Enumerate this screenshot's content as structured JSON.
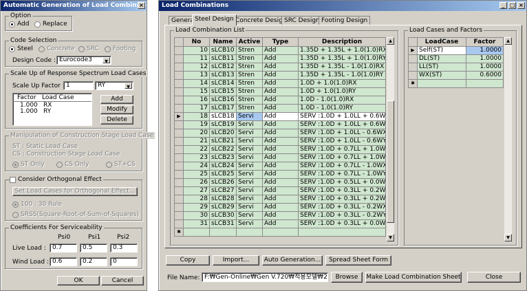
{
  "left": {
    "title": "Automatic Generation of Load Combinatio...",
    "close": "×",
    "option": {
      "label": "Option",
      "add": "Add",
      "replace": "Replace"
    },
    "code": {
      "label": "Code Selection",
      "steel": "Steel",
      "concrete": "Concrete",
      "src": "SRC",
      "footing": "Footing",
      "design_code_label": "Design Code :",
      "design_code_value": "Eurocode3"
    },
    "scale": {
      "label": "Scale Up of Response Spectrum Load Cases",
      "factor_label": "Scale Up Factor :",
      "factor_value": "1",
      "case_value": "RY",
      "col_factor": "Factor",
      "col_case": "Load Case",
      "rows": [
        {
          "factor": "1.000",
          "case": "RX"
        },
        {
          "factor": "1.000",
          "case": "RY"
        }
      ],
      "add": "Add",
      "modify": "Modify",
      "delete": "Delete"
    },
    "stage": {
      "label": "Manipulation of Construction Stage Load Case",
      "st": "ST : Static Load Case",
      "cs": "CS : Construction Stage Load Case",
      "st_only": "ST Only",
      "cs_only": "CS Only",
      "st_cs": "ST+CS"
    },
    "ortho": {
      "label": "Consider Orthogonal Effect",
      "set_btn": "Set Load Cases for Orthogonal Effect...",
      "r100": "100 : 30 Rule",
      "srss": "SRSS(Square-Root-of-Sum-of-Squares)"
    },
    "coef": {
      "label": "Coefficients For Serviceability",
      "psi0": "Psi0",
      "psi1": "Psi1",
      "psi2": "Psi2",
      "live": "Live Load :",
      "wind": "Wind Load :",
      "live_vals": [
        "0.7",
        "0.5",
        "0.3"
      ],
      "wind_vals": [
        "0.6",
        "0.2",
        "0"
      ]
    },
    "ok": "OK",
    "cancel": "Cancel"
  },
  "right": {
    "title": "Load Combinations",
    "min": "_",
    "max": "□",
    "close": "×",
    "tabs": [
      "General",
      "Steel Design",
      "Concrete Design",
      "SRC Design",
      "Footing Design"
    ],
    "lc_list_label": "Load Combination List",
    "cols": [
      "No",
      "Name",
      "Active",
      "Type",
      "Description"
    ],
    "rows": [
      [
        "10",
        "sLCB10",
        "Stren",
        "Add",
        "1.35D + 1.35L + 1.0(1.0)RX"
      ],
      [
        "11",
        "sLCB11",
        "Stren",
        "Add",
        "1.35D + 1.35L + 1.0(1.0)RY"
      ],
      [
        "12",
        "sLCB12",
        "Stren",
        "Add",
        "1.35D + 1.35L - 1.0(1.0)RX"
      ],
      [
        "13",
        "sLCB13",
        "Stren",
        "Add",
        "1.35D + 1.35L - 1.0(1.0)RY"
      ],
      [
        "14",
        "sLCB14",
        "Stren",
        "Add",
        "1.0D + 1.0(1.0)RX"
      ],
      [
        "15",
        "sLCB15",
        "Stren",
        "Add",
        "1.0D + 1.0(1.0)RY"
      ],
      [
        "16",
        "sLCB16",
        "Stren",
        "Add",
        "1.0D - 1.0(1.0)RX"
      ],
      [
        "17",
        "sLCB17",
        "Stren",
        "Add",
        "1.0D - 1.0(1.0)RY"
      ],
      [
        "18",
        "sLCB18",
        "Servi",
        "Add",
        "SERV :1.0D + 1.0LL + 0.6WX"
      ],
      [
        "19",
        "sLCB19",
        "Servi",
        "Add",
        "SERV :1.0D + 1.0LL + 0.6WY"
      ],
      [
        "20",
        "sLCB20",
        "Servi",
        "Add",
        "SERV :1.0D + 1.0LL - 0.6WX"
      ],
      [
        "21",
        "sLCB21",
        "Servi",
        "Add",
        "SERV :1.0D + 1.0LL - 0.6WY"
      ],
      [
        "22",
        "sLCB22",
        "Servi",
        "Add",
        "SERV :1.0D + 0.7LL + 1.0WX"
      ],
      [
        "23",
        "sLCB23",
        "Servi",
        "Add",
        "SERV :1.0D + 0.7LL + 1.0WY"
      ],
      [
        "24",
        "sLCB24",
        "Servi",
        "Add",
        "SERV :1.0D + 0.7LL - 1.0WX"
      ],
      [
        "25",
        "sLCB25",
        "Servi",
        "Add",
        "SERV :1.0D + 0.7LL - 1.0WY"
      ],
      [
        "26",
        "sLCB26",
        "Servi",
        "Add",
        "SERV :1.0D + 0.5LL + 0.0WL"
      ],
      [
        "27",
        "sLCB27",
        "Servi",
        "Add",
        "SERV :1.0D + 0.3LL + 0.2WX"
      ],
      [
        "28",
        "sLCB28",
        "Servi",
        "Add",
        "SERV :1.0D + 0.3LL + 0.2WY"
      ],
      [
        "29",
        "sLCB29",
        "Servi",
        "Add",
        "SERV :1.0D + 0.3LL - 0.2WX"
      ],
      [
        "30",
        "sLCB30",
        "Servi",
        "Add",
        "SERV :1.0D + 0.3LL - 0.2WY"
      ],
      [
        "31",
        "sLCB31",
        "Servi",
        "Add",
        "SERV :1.0D + 0.3LL + 0.0WL"
      ]
    ],
    "lcf_label": "Load Cases and Factors",
    "lcf_cols": [
      "LoadCase",
      "Factor"
    ],
    "lcf_rows": [
      [
        "Self(ST)",
        "1.0000"
      ],
      [
        "DL(ST)",
        "1.0000"
      ],
      [
        "LL(ST)",
        "1.0000"
      ],
      [
        "WX(ST)",
        "0.6000"
      ]
    ],
    "buttons": {
      "copy": "Copy",
      "import": "Import...",
      "auto": "Auto Generation...",
      "spread": "Spread Sheet Form",
      "file_label": "File Name:",
      "file_value": "F:₩Gen-Online₩Gen V.720₩적용모델₩2393_Ri",
      "browse": "Browse",
      "make": "Make Load Combination Sheet",
      "close": "Close"
    }
  }
}
